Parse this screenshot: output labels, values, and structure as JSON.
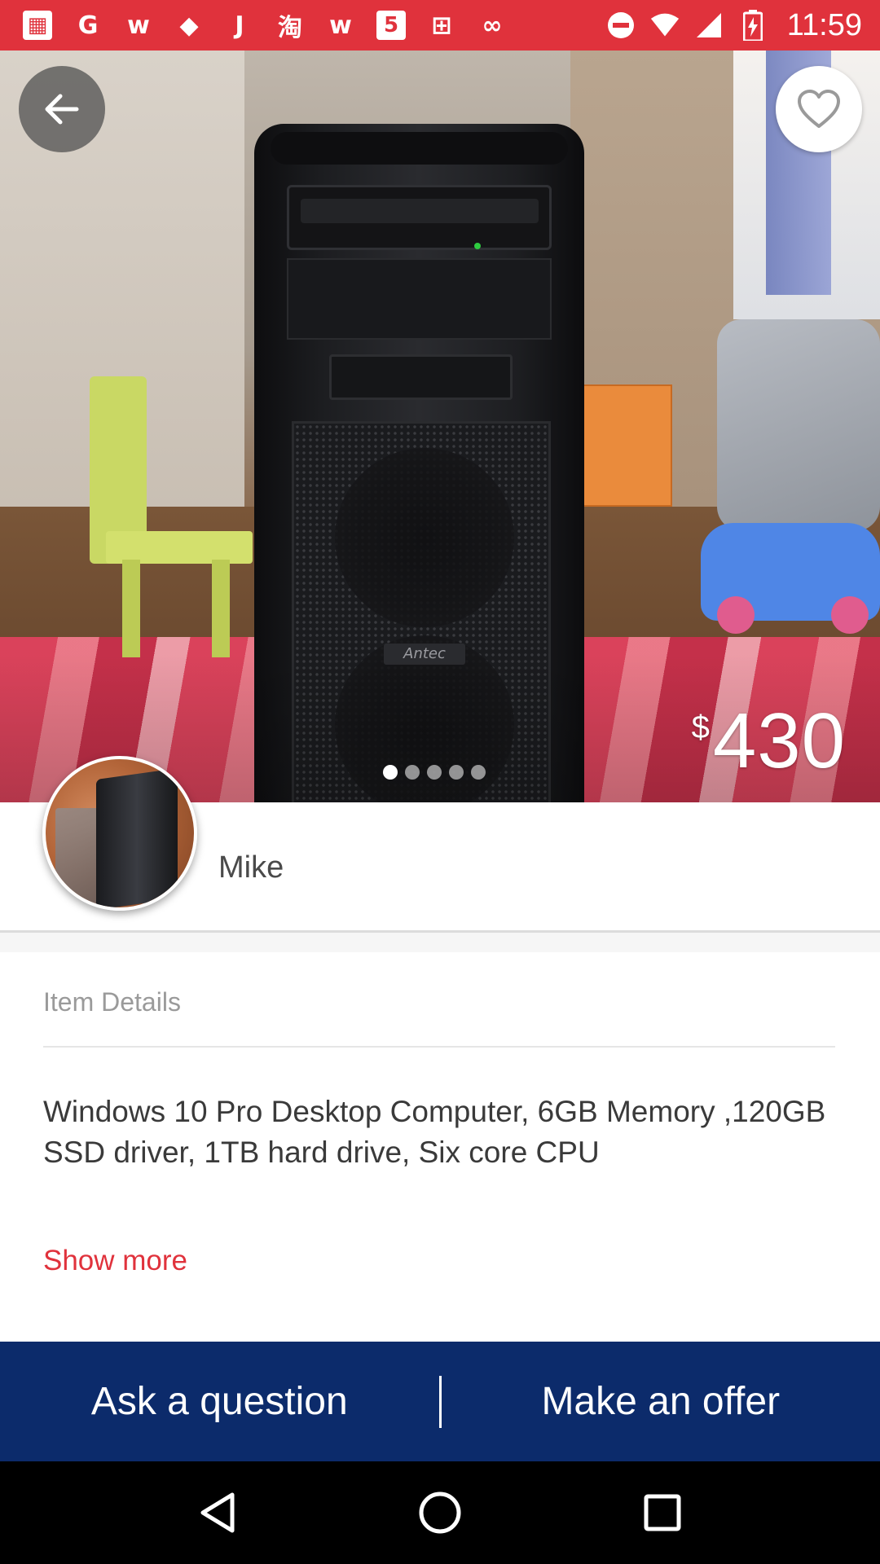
{
  "status_bar": {
    "time": "11:59",
    "notification_icons": [
      {
        "icon": "calendar-icon",
        "glyph": "▦"
      },
      {
        "icon": "g-app-icon",
        "glyph": "G"
      },
      {
        "icon": "w-app-icon",
        "glyph": "w"
      },
      {
        "icon": "shop-icon",
        "glyph": "◆"
      },
      {
        "icon": "j-app-icon",
        "glyph": "J"
      },
      {
        "icon": "taobao-icon",
        "glyph": "淘"
      },
      {
        "icon": "w-app-icon-2",
        "glyph": "w"
      },
      {
        "icon": "number-5-icon",
        "glyph": "5"
      },
      {
        "icon": "grid-app-icon",
        "glyph": "⊞"
      },
      {
        "icon": "link-icon",
        "glyph": "∞"
      }
    ],
    "system_icons": [
      "do-not-disturb-icon",
      "wifi-icon",
      "signal-icon",
      "battery-charging-icon"
    ]
  },
  "listing": {
    "price_currency": "$",
    "price": "430",
    "photo_count": 5,
    "active_photo_index": 0,
    "seller_name": "Mike",
    "details_title": "Item Details",
    "description": "Windows 10 Pro Desktop Computer, 6GB Memory ,120GB SSD driver, 1TB hard drive, Six core CPU",
    "show_more_label": "Show more",
    "photo_brand_text": "Antec"
  },
  "actions": {
    "ask_label": "Ask a question",
    "offer_label": "Make an offer"
  },
  "colors": {
    "accent": "#e0323c",
    "action_bar": "#0c2b6b",
    "text_primary": "#3a3a3a",
    "text_muted": "#9a9a9a"
  }
}
